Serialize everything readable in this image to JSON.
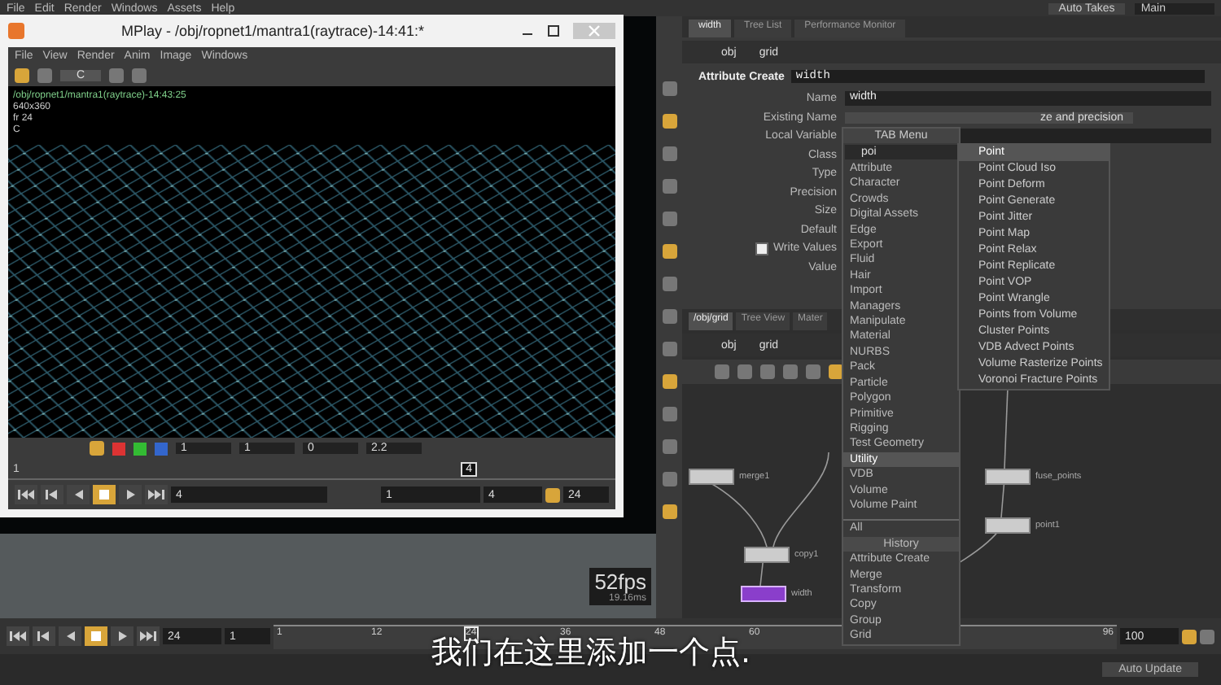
{
  "menubar": {
    "items": [
      "File",
      "Edit",
      "Render",
      "Windows",
      "Assets",
      "Help"
    ],
    "auto_takes": "Auto Takes",
    "take": "Main"
  },
  "mplay": {
    "title": "MPlay - /obj/ropnet1/mantra1(raytrace)-14:41:*",
    "menus": [
      "File",
      "View",
      "Render",
      "Anim",
      "Image",
      "Windows"
    ],
    "channel": "C",
    "info": [
      "/obj/ropnet1/mantra1(raytrace)-14:43:25",
      "640x360",
      "fr 24",
      "C"
    ],
    "display_fields": [
      "1",
      "1",
      "0",
      "2.2"
    ],
    "frame_marker": "4",
    "ruler_start": "1",
    "frame": "4",
    "range_start": "1",
    "range_end": "4",
    "fps": "24",
    "playback": [
      {
        "kind": "first",
        "selected": false
      },
      {
        "kind": "prev",
        "selected": false
      },
      {
        "kind": "back",
        "selected": false
      },
      {
        "kind": "stop",
        "selected": true
      },
      {
        "kind": "play",
        "selected": false
      },
      {
        "kind": "last",
        "selected": false
      }
    ]
  },
  "param_panel": {
    "tabs": [
      {
        "label": "width",
        "selected": true
      },
      {
        "label": "Tree List",
        "selected": false
      },
      {
        "label": "Performance Monitor",
        "selected": false
      }
    ],
    "path": [
      "obj",
      "grid"
    ],
    "node_type": "Attribute Create",
    "node_name": "width",
    "params": [
      {
        "label": "Name",
        "value": "width",
        "kind": "text"
      },
      {
        "label": "Existing Name",
        "value": "ze and precision",
        "kind": "menu"
      },
      {
        "label": "Local Variable",
        "kind": "text"
      },
      {
        "label": "Class",
        "kind": "plain"
      },
      {
        "label": "Type",
        "kind": "plain"
      },
      {
        "label": "Precision",
        "kind": "plain"
      },
      {
        "label": "Size",
        "kind": "plain"
      },
      {
        "label": "Default",
        "kind": "plain"
      },
      {
        "label": "Write Values",
        "kind": "check",
        "checked": true
      },
      {
        "label": "Value",
        "kind": "plain"
      }
    ]
  },
  "network": {
    "tabs": [
      {
        "label": "/obj/grid",
        "selected": true
      },
      {
        "label": "Tree View",
        "selected": false
      },
      {
        "label": "Mater",
        "selected": false
      }
    ],
    "path": [
      "obj",
      "grid"
    ],
    "nodes": [
      {
        "label": "merge1",
        "selected": false
      },
      {
        "label": "copy1",
        "selected": false
      },
      {
        "label": "width",
        "selected": true
      },
      {
        "label": "fuse_points",
        "selected": false
      },
      {
        "label": "point1",
        "selected": false
      }
    ]
  },
  "viewport": {
    "fps": "52fps",
    "time": "19.16ms"
  },
  "tab_menu": {
    "title": "TAB Menu",
    "search": "poi",
    "categories": [
      {
        "label": "Attribute",
        "selected": false
      },
      {
        "label": "Character",
        "selected": false
      },
      {
        "label": "Crowds",
        "selected": false
      },
      {
        "label": "Digital Assets",
        "selected": false
      },
      {
        "label": "Edge",
        "selected": false
      },
      {
        "label": "Export",
        "selected": false
      },
      {
        "label": "Fluid",
        "selected": false
      },
      {
        "label": "Hair",
        "selected": false
      },
      {
        "label": "Import",
        "selected": false
      },
      {
        "label": "Managers",
        "selected": false
      },
      {
        "label": "Manipulate",
        "selected": false
      },
      {
        "label": "Material",
        "selected": false
      },
      {
        "label": "NURBS",
        "selected": false
      },
      {
        "label": "Pack",
        "selected": false
      },
      {
        "label": "Particle",
        "selected": false
      },
      {
        "label": "Polygon",
        "selected": false
      },
      {
        "label": "Primitive",
        "selected": false
      },
      {
        "label": "Rigging",
        "selected": false
      },
      {
        "label": "Test Geometry",
        "selected": false
      },
      {
        "label": "Utility",
        "selected": true
      },
      {
        "label": "VDB",
        "selected": false
      },
      {
        "label": "Volume",
        "selected": false
      },
      {
        "label": "Volume Paint",
        "selected": false
      }
    ],
    "all": "All",
    "history_title": "History",
    "history": [
      "Attribute Create",
      "Merge",
      "Transform",
      "Copy",
      "Group",
      "Grid"
    ],
    "results": [
      {
        "label": "Point",
        "selected": true
      },
      {
        "label": "Point Cloud Iso",
        "selected": false
      },
      {
        "label": "Point Deform",
        "selected": false
      },
      {
        "label": "Point Generate",
        "selected": false
      },
      {
        "label": "Point Jitter",
        "selected": false
      },
      {
        "label": "Point Map",
        "selected": false
      },
      {
        "label": "Point Relax",
        "selected": false
      },
      {
        "label": "Point Replicate",
        "selected": false
      },
      {
        "label": "Point VOP",
        "selected": false
      },
      {
        "label": "Point Wrangle",
        "selected": false
      },
      {
        "label": "Points from Volume",
        "selected": false
      },
      {
        "label": "Cluster Points",
        "selected": false
      },
      {
        "label": "VDB Advect Points",
        "selected": false
      },
      {
        "label": "Volume Rasterize Points",
        "selected": false
      },
      {
        "label": "Voronoi Fracture Points",
        "selected": false
      }
    ]
  },
  "timeline": {
    "frame": "24",
    "start": "1",
    "ticks": [
      {
        "label": "1",
        "selected": false
      },
      {
        "label": "12",
        "selected": false
      },
      {
        "label": "24",
        "selected": true
      },
      {
        "label": "36",
        "selected": false
      },
      {
        "label": "48",
        "selected": false
      },
      {
        "label": "60",
        "selected": false
      },
      {
        "label": "96",
        "selected": false
      }
    ],
    "end": "100",
    "auto_update": "Auto Update",
    "playback": [
      {
        "kind": "first",
        "selected": false
      },
      {
        "kind": "prev",
        "selected": false
      },
      {
        "kind": "back",
        "selected": false
      },
      {
        "kind": "stop",
        "selected": true
      },
      {
        "kind": "play",
        "selected": false
      },
      {
        "kind": "last",
        "selected": false
      }
    ]
  },
  "subtitle": "我们在这里添加一个点."
}
